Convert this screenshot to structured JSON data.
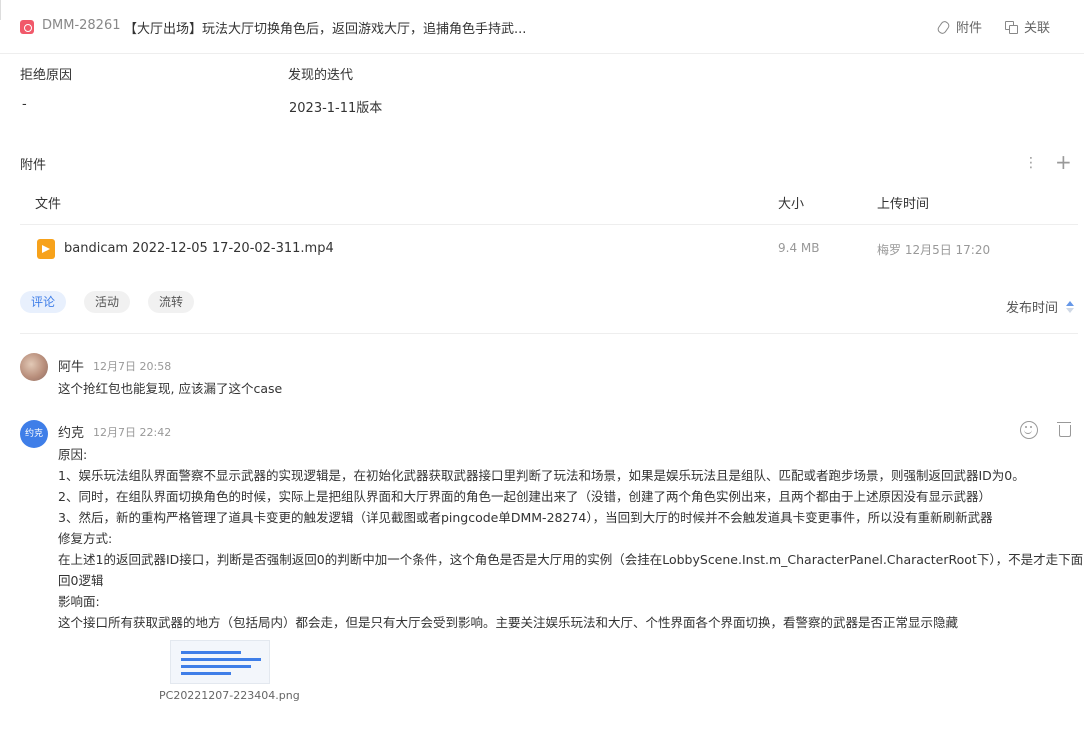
{
  "header": {
    "issue_id": "DMM-28261",
    "title": "【大厅出场】玩法大厅切换角色后，返回游戏大厅，追捕角色手持武...",
    "attach_label": "附件",
    "link_label": "关联"
  },
  "fields": [
    {
      "label": "拒绝原因",
      "value": "-"
    },
    {
      "label": "发现的迭代",
      "value": "2023-1-11版本"
    }
  ],
  "attachments": {
    "title": "附件",
    "columns": {
      "file": "文件",
      "size": "大小",
      "uploaded": "上传时间"
    },
    "rows": [
      {
        "name": "bandicam 2022-12-05 17-20-02-311.mp4",
        "size": "9.4 MB",
        "uploaded": "梅罗 12月5日 17:20"
      }
    ]
  },
  "tabs": [
    {
      "label": "评论",
      "active": true
    },
    {
      "label": "活动",
      "active": false
    },
    {
      "label": "流转",
      "active": false
    }
  ],
  "sort_label": "发布时间",
  "comments": [
    {
      "author": "阿牛",
      "time": "12月7日 20:58",
      "lines": [
        "这个抢红包也能复现, 应该漏了这个case"
      ]
    },
    {
      "author": "约克",
      "avatar_text": "约克",
      "time": "12月7日 22:42",
      "lines": [
        "原因:",
        "1、娱乐玩法组队界面警察不显示武器的实现逻辑是，在初始化武器获取武器接口里判断了玩法和场景，如果是娱乐玩法且是组队、匹配或者跑步场景，则强制返回武器ID为0。",
        "2、同时，在组队界面切换角色的时候，实际上是把组队界面和大厅界面的角色一起创建出来了（没错，创建了两个角色实例出来，且两个都由于上述原因没有显示武器）",
        "3、然后，新的重构严格管理了道具卡变更的触发逻辑（详见截图或者pingcode单DMM-28274），当回到大厅的时候并不会触发道具卡变更事件，所以没有重新刷新武器",
        "修复方式:",
        "在上述1的返回武器ID接口，判断是否强制返回0的判断中加一个条件，这个角色是否是大厅用的实例（会挂在LobbyScene.Inst.m_CharacterPanel.CharacterRoot下），不是才走下面的返",
        "回0逻辑",
        "影响面:",
        "这个接口所有获取武器的地方（包括局内）都会走，但是只有大厅会受到影响。主要关注娱乐玩法和大厅、个性界面各个界面切换，看警察的武器是否正常显示隐藏"
      ],
      "image_name": "PC20221207-223404.png"
    }
  ],
  "colors": {
    "accent": "#3f7ee8",
    "issue_icon": "#f1596a",
    "file_icon": "#f7a21b"
  }
}
